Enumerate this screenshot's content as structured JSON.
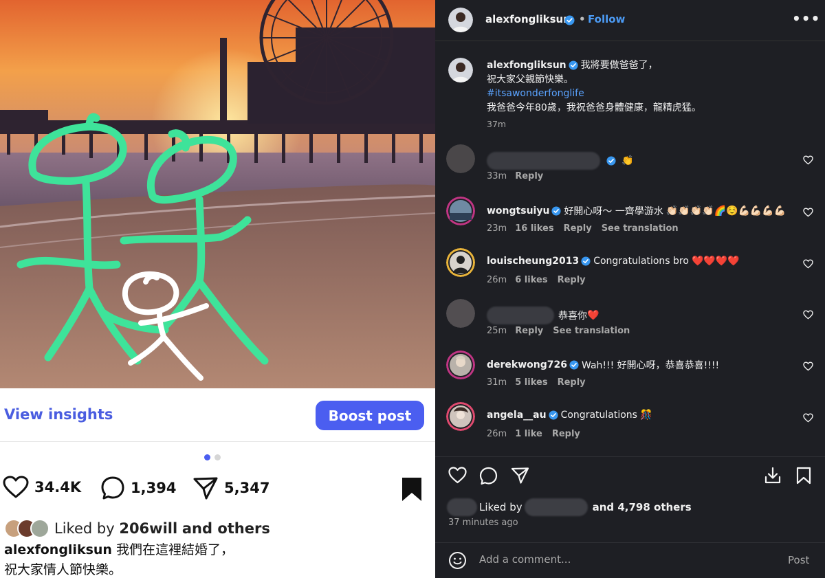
{
  "left": {
    "view_insights": "View insights",
    "boost_post": "Boost post",
    "carousel": {
      "count": 2,
      "active": 1
    },
    "stats": {
      "likes": "34.4K",
      "comments": "1,394",
      "shares": "5,347"
    },
    "liked_by": {
      "prefix": "Liked by",
      "user": "206will",
      "suffix": "and others"
    },
    "caption": {
      "username": "alexfongliksun",
      "line1": "我們在這裡結婚了，",
      "line2": "祝大家情人節快樂。"
    },
    "colors": {
      "accent": "#4b5ef0",
      "drawing_green": "#3ee39a",
      "drawing_white": "#ffffff"
    }
  },
  "right": {
    "header": {
      "username": "alexfongliksun",
      "dot": "•",
      "follow": "Follow",
      "more": "•••"
    },
    "caption": {
      "username": "alexfongliksun",
      "line1": "我將要做爸爸了，",
      "line2": "祝大家父親節快樂。",
      "hashtag": "#itsawonderfonglife",
      "line4": "我爸爸今年80歲，我祝爸爸身體健康，龍精虎猛。",
      "time": "37m"
    },
    "comments": [
      {
        "username": "",
        "blurred": true,
        "text": "",
        "emoji": "👏",
        "time": "33m",
        "likes": "",
        "reply": "Reply",
        "translation": ""
      },
      {
        "username": "wongtsuiyu",
        "blurred": false,
        "text": "好開心呀～ 一齊學游水",
        "emoji": "👏🏻👏🏻👏🏻👏🏻🌈☺️💪🏻💪🏻💪🏻💪🏻",
        "time": "23m",
        "likes": "16 likes",
        "reply": "Reply",
        "translation": "See translation"
      },
      {
        "username": "louischeung2013",
        "blurred": false,
        "text": "Congratulations bro",
        "emoji": "❤️❤️❤️❤️",
        "time": "26m",
        "likes": "6 likes",
        "reply": "Reply",
        "translation": ""
      },
      {
        "username": "",
        "blurred": true,
        "text": "恭喜你",
        "emoji": "❤️",
        "time": "25m",
        "likes": "",
        "reply": "Reply",
        "translation": "See translation"
      },
      {
        "username": "derekwong726",
        "blurred": false,
        "text": "Wah!!! 好開心呀，恭喜恭喜!!!!",
        "emoji": "",
        "time": "31m",
        "likes": "5 likes",
        "reply": "Reply",
        "translation": ""
      },
      {
        "username": "angela__au",
        "blurred": false,
        "text": "Congratulations",
        "emoji": "🎊",
        "time": "26m",
        "likes": "1 like",
        "reply": "Reply",
        "translation": ""
      }
    ],
    "footer": {
      "liked_by_prefix": "Liked by",
      "liked_by_suffix": "and 4,798 others",
      "time": "37 minutes ago",
      "comment_placeholder": "Add a comment...",
      "post": "Post"
    },
    "colors": {
      "background": "#1e1f24",
      "link": "#4c9bf5",
      "hashtag": "#5aa3ff",
      "muted": "#a8a8a8",
      "verified": "#3897f0"
    }
  }
}
